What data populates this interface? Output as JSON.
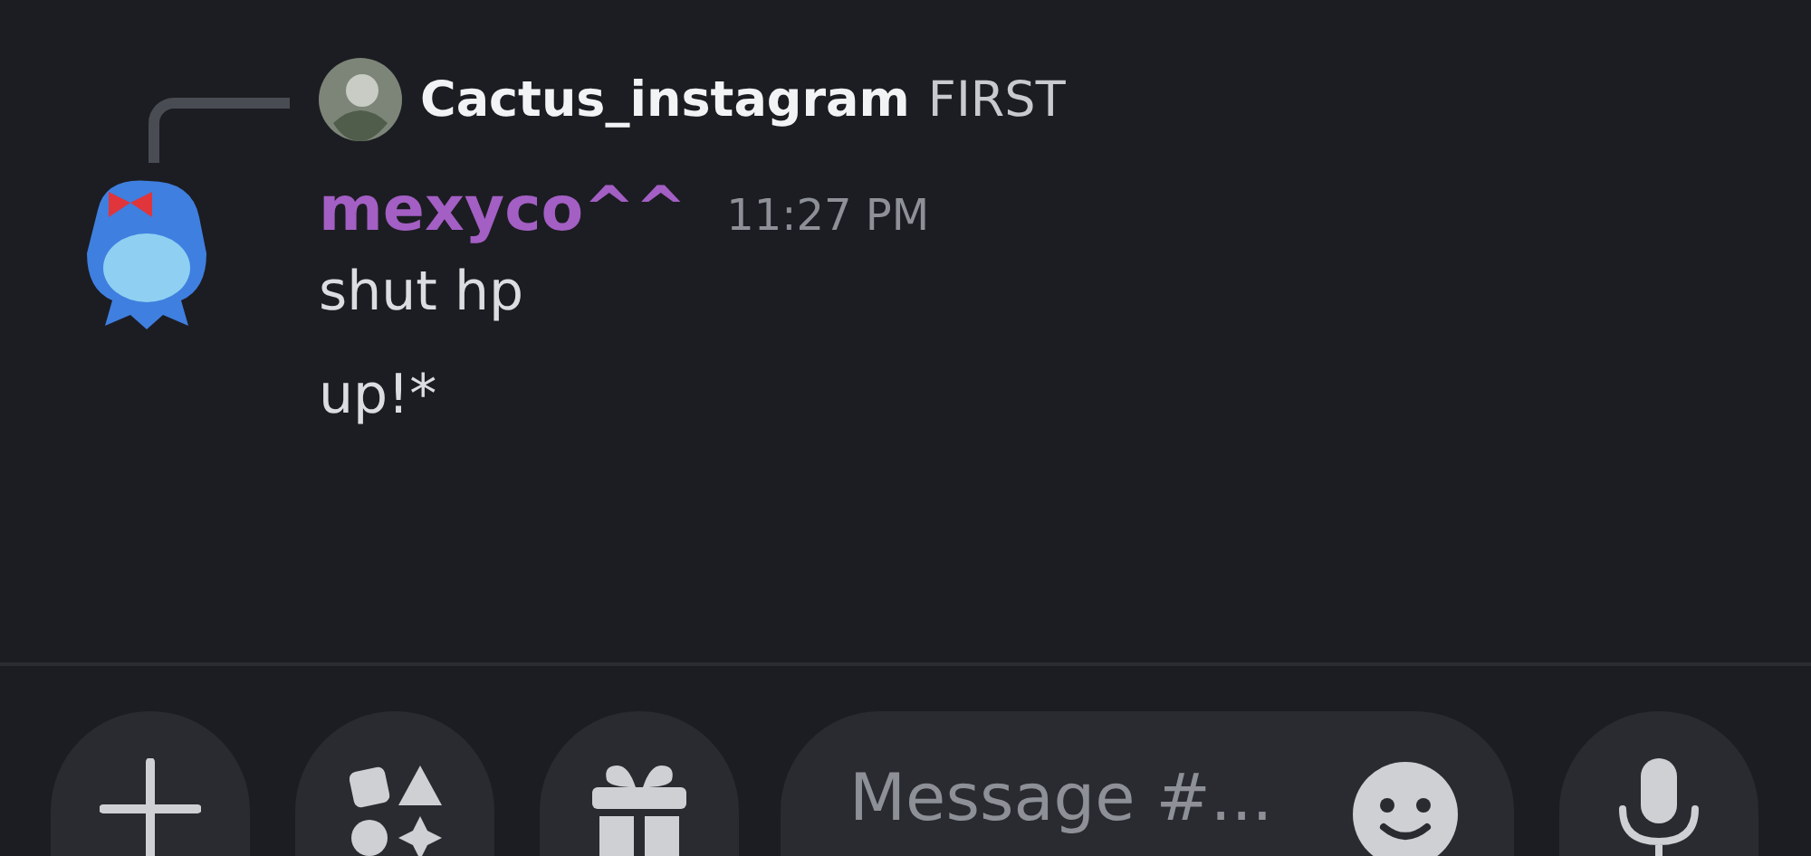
{
  "reply": {
    "author": "Cactus_instagram",
    "text": "FIRST"
  },
  "message": {
    "author": "mexyco^^",
    "time": "11:27 PM",
    "lines": [
      "shut hp",
      "up!*"
    ]
  },
  "composer": {
    "placeholder": "Message #..."
  }
}
